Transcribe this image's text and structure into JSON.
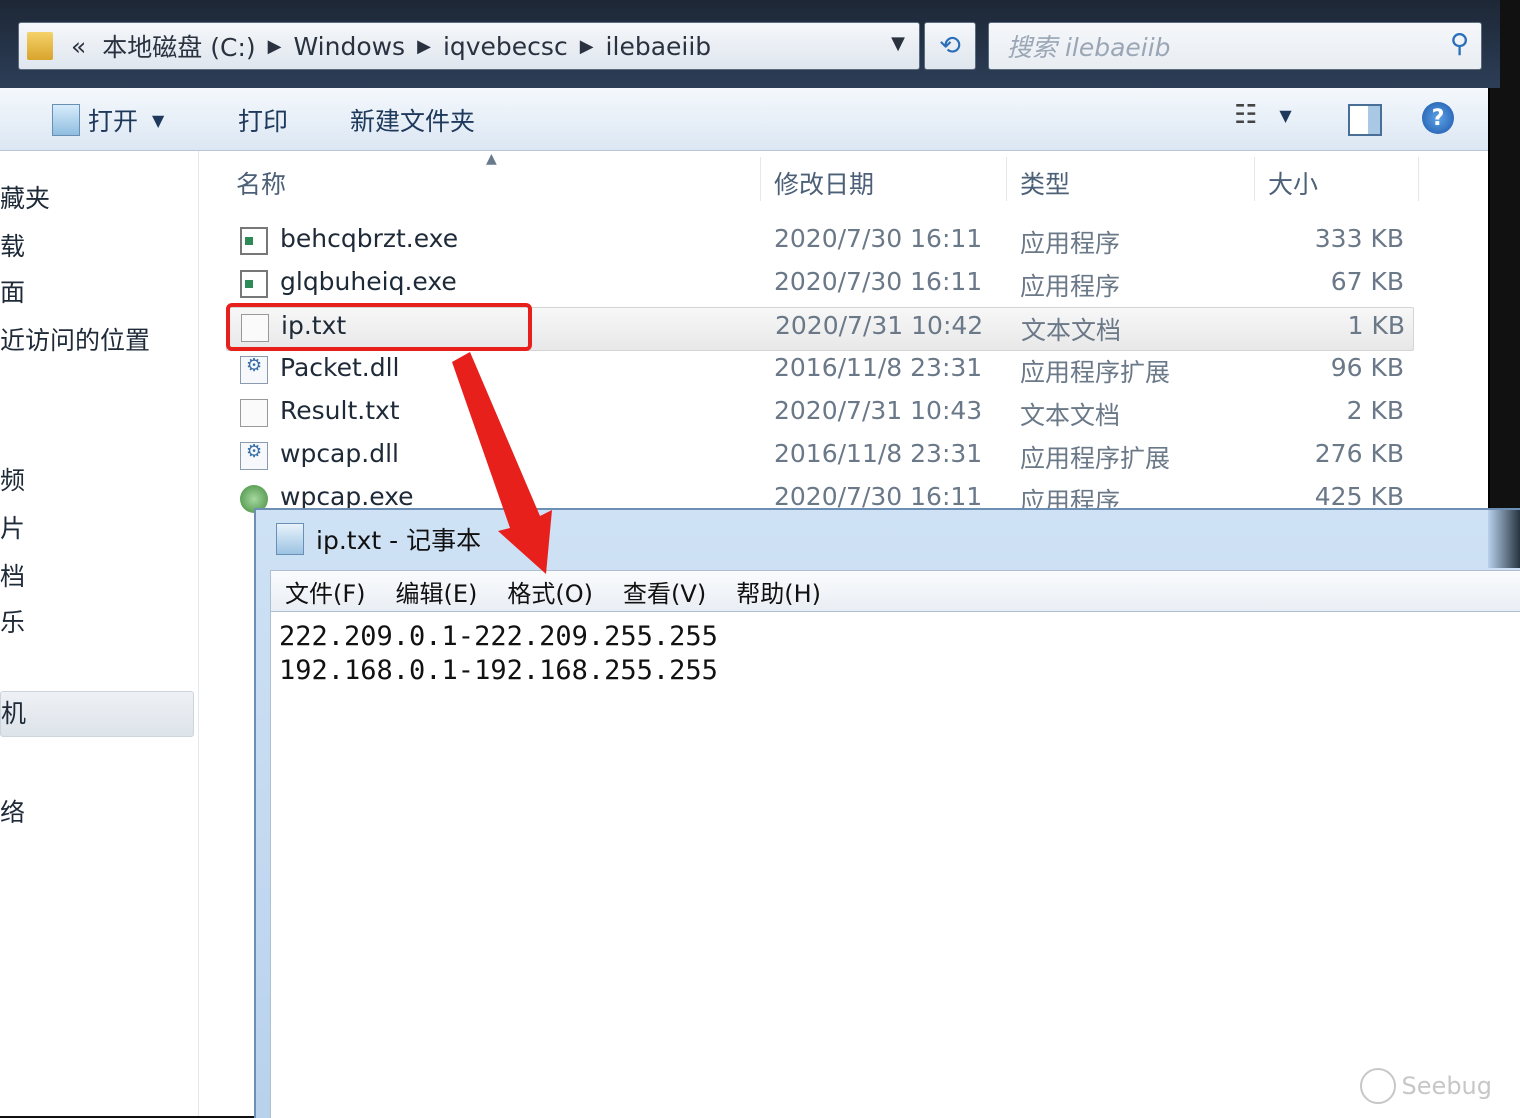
{
  "explorer": {
    "address": {
      "overflow": "«",
      "crumbs": [
        "本地磁盘 (C:)",
        "Windows",
        "iqvebecsc",
        "ilebaeiib"
      ]
    },
    "search_placeholder": "搜索 ilebaeiib",
    "toolbar": {
      "open_label": "打开",
      "print_label": "打印",
      "new_folder_label": "新建文件夹"
    },
    "sidebar": {
      "items": [
        "收藏夹",
        "下载",
        "桌面",
        "最近访问的位置",
        "视频",
        "图片",
        "文档",
        "音乐",
        "计算机",
        "网络"
      ],
      "visible_items": [
        "藏夹",
        "载",
        "面",
        "近访问的位置",
        "频",
        "片",
        "档",
        "乐",
        "机",
        "络"
      ]
    },
    "columns": {
      "name": "名称",
      "date": "修改日期",
      "type": "类型",
      "size": "大小"
    },
    "files": [
      {
        "name": "behcqbrzt.exe",
        "date": "2020/7/30 16:11",
        "type": "应用程序",
        "size": "333 KB",
        "icon": "exe-icon"
      },
      {
        "name": "glqbuheiq.exe",
        "date": "2020/7/30 16:11",
        "type": "应用程序",
        "size": "67 KB",
        "icon": "exe-icon"
      },
      {
        "name": "ip.txt",
        "date": "2020/7/31 10:42",
        "type": "文本文档",
        "size": "1 KB",
        "icon": "text-file-icon"
      },
      {
        "name": "Packet.dll",
        "date": "2016/11/8 23:31",
        "type": "应用程序扩展",
        "size": "96 KB",
        "icon": "dll-icon"
      },
      {
        "name": "Result.txt",
        "date": "2020/7/31 10:43",
        "type": "文本文档",
        "size": "2 KB",
        "icon": "text-file-icon"
      },
      {
        "name": "wpcap.dll",
        "date": "2016/11/8 23:31",
        "type": "应用程序扩展",
        "size": "276 KB",
        "icon": "dll-icon"
      },
      {
        "name": "wpcap.exe",
        "date": "2020/7/30 16:11",
        "type": "应用程序",
        "size": "425 KB",
        "icon": "globe-exe-icon"
      }
    ]
  },
  "notepad": {
    "title": "ip.txt - 记事本",
    "menu": [
      "文件(F)",
      "编辑(E)",
      "格式(O)",
      "查看(V)",
      "帮助(H)"
    ],
    "lines": [
      "222.209.0.1-222.209.255.255",
      "192.168.0.1-192.168.255.255"
    ]
  },
  "annotation": {
    "color": "#e8201c"
  },
  "watermark": "Seebug"
}
